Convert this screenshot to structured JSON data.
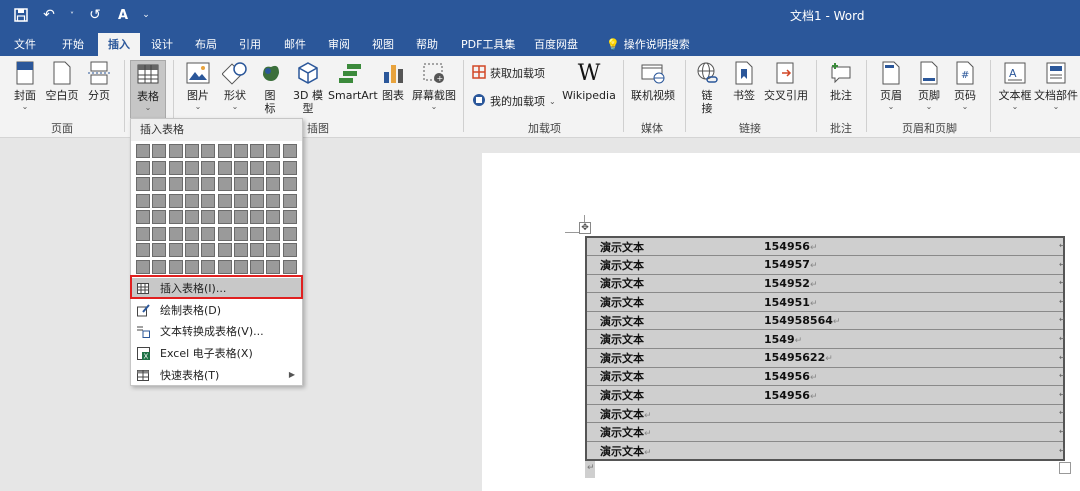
{
  "window": {
    "title": "文档1 - Word"
  },
  "tabs": [
    "文件",
    "开始",
    "插入",
    "设计",
    "布局",
    "引用",
    "邮件",
    "审阅",
    "视图",
    "帮助",
    "PDF工具集",
    "百度网盘",
    "操作说明搜索"
  ],
  "active_tab": "插入",
  "ribbon": {
    "buttons": {
      "cover": "封面",
      "blank": "空白页",
      "break": "分页",
      "table": "表格",
      "picture": "图片",
      "shape": "形状",
      "icon_a": "图",
      "icon_b": "标",
      "model_a": "3D 模",
      "model_b": "型",
      "smartart": "SmartArt",
      "chart": "图表",
      "screenshot": "屏幕截图",
      "get_addins": "获取加载项",
      "my_addins": "我的加载项",
      "wikipedia": "Wikipedia",
      "online_video": "联机视频",
      "link_a": "链",
      "link_b": "接",
      "bookmark": "书签",
      "crossref": "交叉引用",
      "comment": "批注",
      "header": "页眉",
      "footer": "页脚",
      "pagenum": "页码",
      "textbox": "文本框",
      "docparts": "文档部件"
    },
    "groups": {
      "pages": "页面",
      "illustrations": "插图",
      "addins": "加载项",
      "media": "媒体",
      "links": "链接",
      "comments": "批注",
      "headerfooter": "页眉和页脚"
    }
  },
  "dropdown": {
    "title": "插入表格",
    "items": [
      {
        "label": "插入表格(I)...",
        "icon": "table-icon"
      },
      {
        "label": "绘制表格(D)",
        "icon": "pencil-table-icon"
      },
      {
        "label": "文本转换成表格(V)...",
        "icon": "text-to-table-icon"
      },
      {
        "label": "Excel 电子表格(X)",
        "icon": "excel-icon"
      },
      {
        "label": "快速表格(T)",
        "icon": "quick-table-icon"
      }
    ]
  },
  "document": {
    "rows": [
      {
        "a": "演示文本",
        "b": "154956"
      },
      {
        "a": "演示文本",
        "b": "154957"
      },
      {
        "a": "演示文本",
        "b": "154952"
      },
      {
        "a": "演示文本",
        "b": "154951"
      },
      {
        "a": "演示文本",
        "b": "154958564"
      },
      {
        "a": "演示文本",
        "b": "1549"
      },
      {
        "a": "演示文本",
        "b": "15495622"
      },
      {
        "a": "演示文本",
        "b": "154956"
      },
      {
        "a": "演示文本",
        "b": "154956"
      },
      {
        "a": "演示文本",
        "b": ""
      },
      {
        "a": "演示文本",
        "b": ""
      },
      {
        "a": "演示文本",
        "b": ""
      }
    ]
  },
  "colors": {
    "accent": "#2b579a",
    "highlight": "#e02020"
  }
}
